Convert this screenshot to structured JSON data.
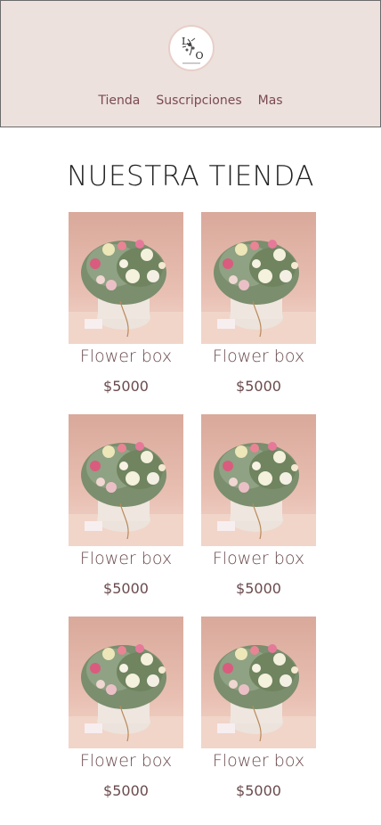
{
  "header": {
    "logo_initials": [
      "L",
      "O"
    ],
    "nav": [
      "Tienda",
      "Suscripciones",
      "Mas"
    ]
  },
  "main": {
    "title": "NUESTRA TIENDA",
    "products": [
      {
        "name": "Flower box",
        "price": "$5000"
      },
      {
        "name": "Flower box",
        "price": "$5000"
      },
      {
        "name": "Flower box",
        "price": "$5000"
      },
      {
        "name": "Flower box",
        "price": "$5000"
      },
      {
        "name": "Flower box",
        "price": "$5000"
      },
      {
        "name": "Flower box",
        "price": "$5000"
      }
    ]
  },
  "colors": {
    "header_bg": "#ede1dd",
    "text_accent": "#7a4a52",
    "product_text": "#6a4a4d"
  }
}
